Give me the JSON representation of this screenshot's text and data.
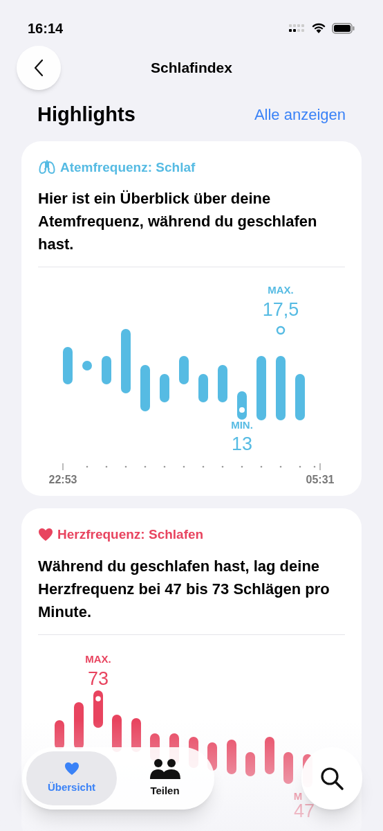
{
  "status_bar": {
    "time": "16:14"
  },
  "nav": {
    "title": "Schlafindex"
  },
  "section": {
    "title": "Highlights",
    "link": "Alle anzeigen"
  },
  "cards": [
    {
      "kind": "breathing",
      "title": "Atemfrequenz: Schlaf",
      "text": "Hier ist ein Überblick über deine Atemfrequenz, während du geschlafen hast.",
      "chart": {
        "max_label": "MAX.",
        "max_value": "17,5",
        "min_label": "MIN.",
        "min_value": "13",
        "start_time": "22:53",
        "end_time": "05:31"
      }
    },
    {
      "kind": "heart",
      "title": "Herzfrequenz: Schlafen",
      "text": "Während du geschlafen hast, lag deine Herzfrequenz bei 47 bis 73 Schlägen pro Minute.",
      "chart": {
        "max_label": "MAX.",
        "max_value": "73",
        "min_label": "M",
        "min_value": "47"
      }
    }
  ],
  "tab_bar": {
    "tabs": [
      {
        "kind": "overview",
        "label": "Übersicht",
        "selected": true
      },
      {
        "kind": "share",
        "label": "Teilen",
        "selected": false
      }
    ]
  }
}
